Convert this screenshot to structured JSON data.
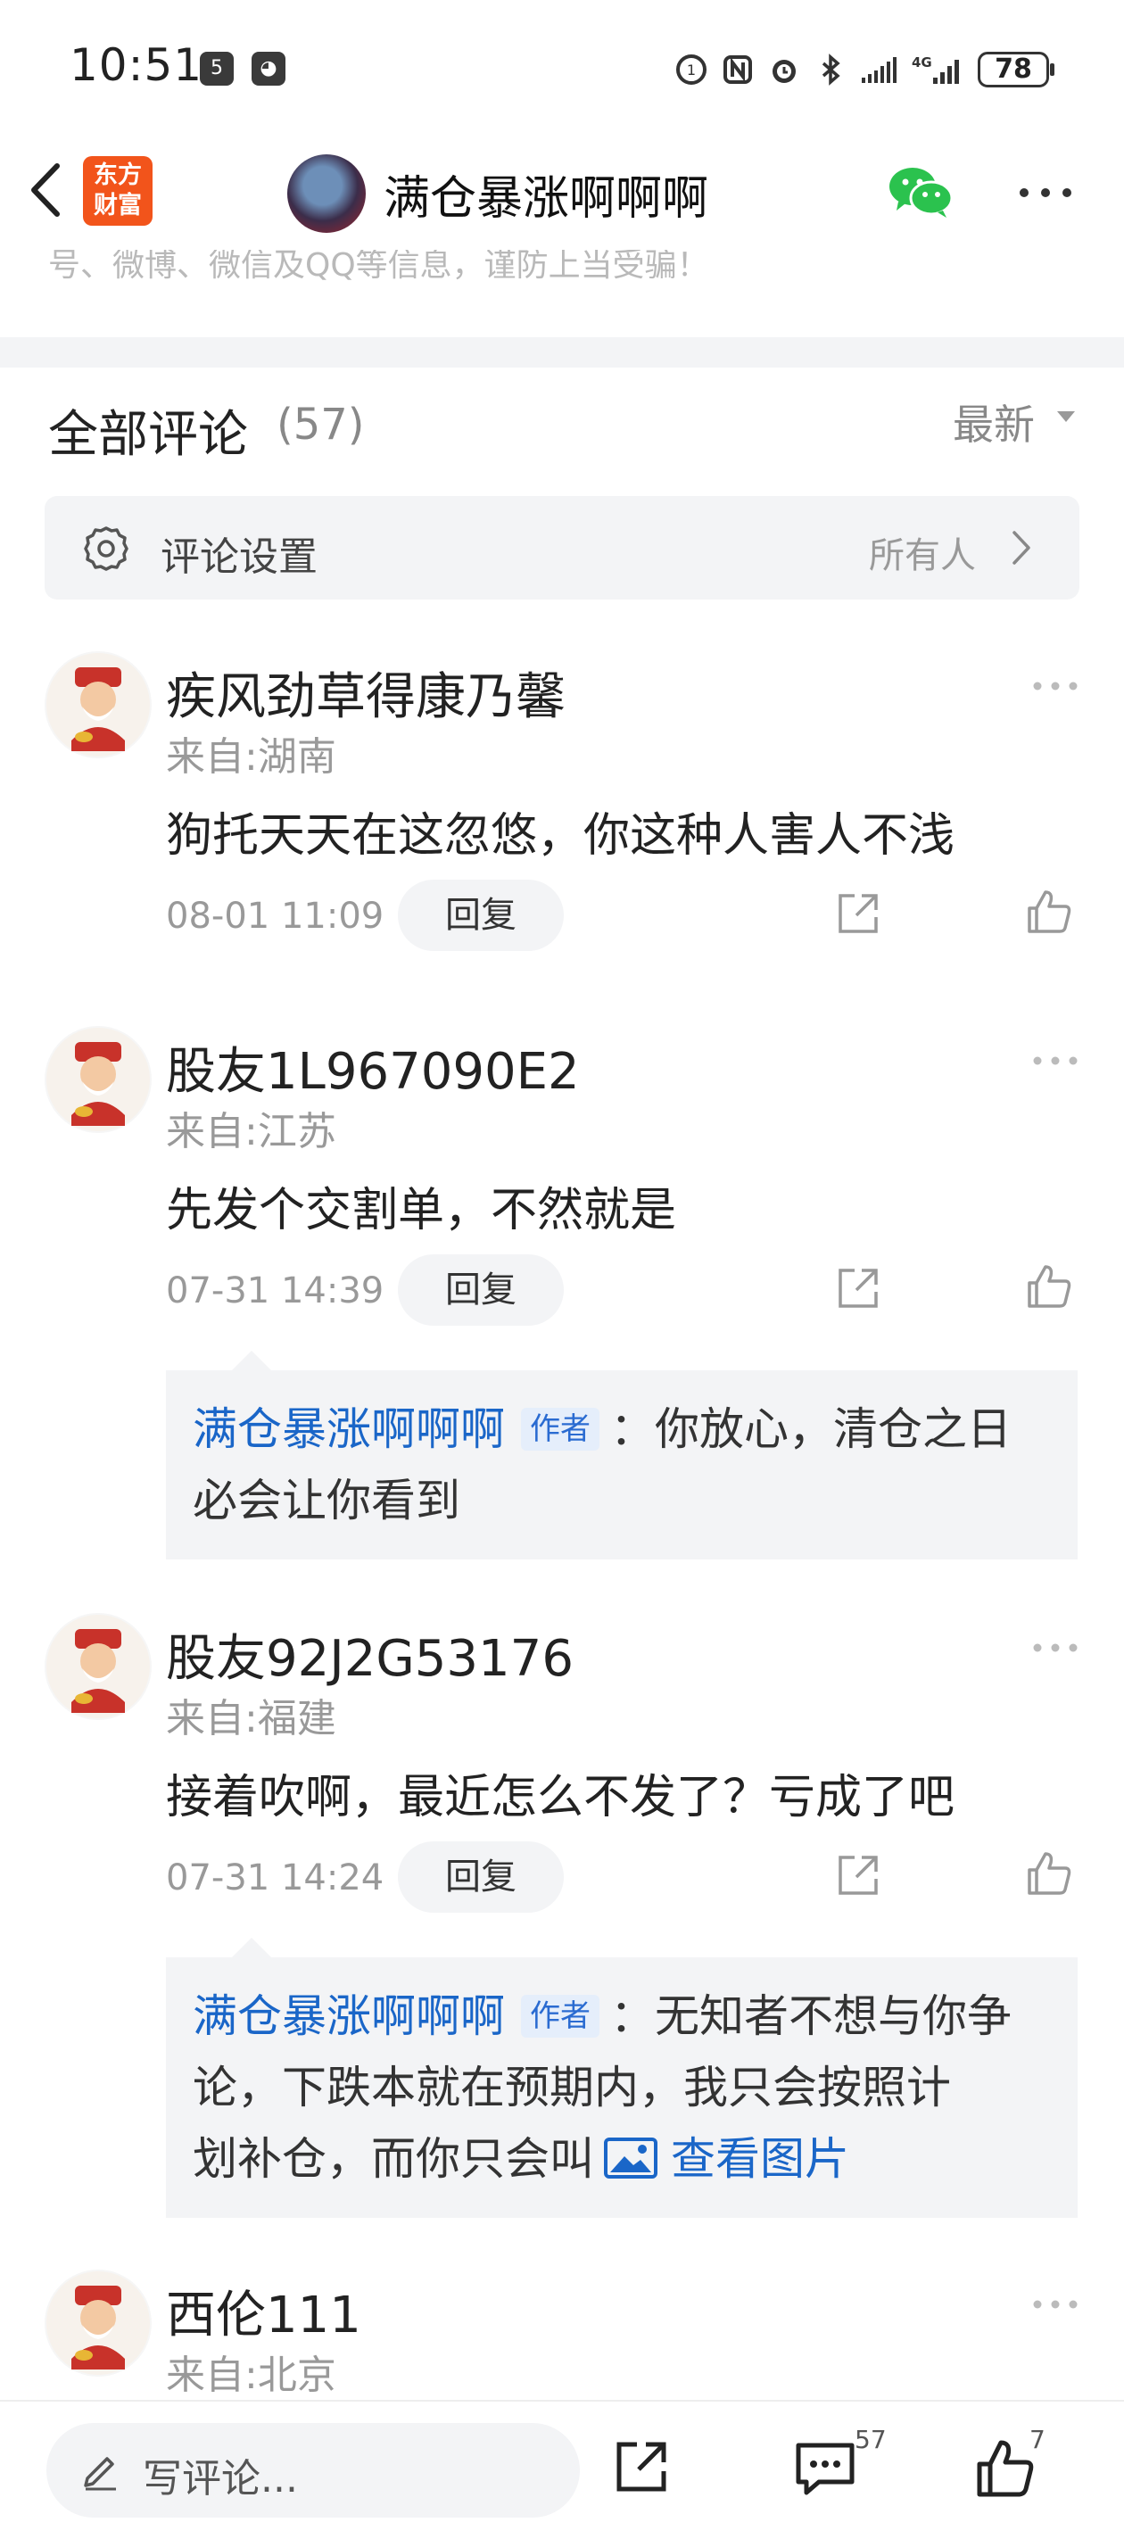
{
  "status_bar": {
    "time": "10:51",
    "network": "4G",
    "battery": "78"
  },
  "title_bar": {
    "logo_text": "东方\n财富",
    "title": "满仓暴涨啊啊啊",
    "icons": [
      "back-icon",
      "wechat-icon",
      "more-icon"
    ]
  },
  "notice": "号、微博、微信及QQ等信息，谨防上当受骗！",
  "comments_header": {
    "title": "全部评论",
    "count": "(57)",
    "sort_label": "最新"
  },
  "settings": {
    "label": "评论设置",
    "value": "所有人"
  },
  "comments": [
    {
      "name": "疾风劲草得康乃馨",
      "location": "来自:湖南",
      "text": "狗托天天在这忽悠，你这种人害人不浅",
      "time": "08-01 11:09",
      "reply_label": "回复"
    },
    {
      "name": "股友1L967090E2",
      "location": "来自:江苏",
      "text": "先发个交割单，不然就是",
      "time": "07-31 14:39",
      "reply_label": "回复",
      "reply": {
        "author": "满仓暴涨啊啊啊",
        "badge": "作者",
        "text_line1": "：你放心，清仓之日",
        "text_line2": "必会让你看到"
      }
    },
    {
      "name": "股友92J2G53176",
      "location": "来自:福建",
      "text": "接着吹啊，最近怎么不发了？亏成了吧",
      "time": "07-31 14:24",
      "reply_label": "回复",
      "reply": {
        "author": "满仓暴涨啊啊啊",
        "badge": "作者",
        "text_line1": "：无知者不想与你争",
        "text_line2": "论，下跌本就在预期内，我只会按照计",
        "text_line3": "划补仓，而你只会叫",
        "image_link": "查看图片"
      }
    },
    {
      "name": "西伦111",
      "location": "来自:北京"
    }
  ],
  "bottom_bar": {
    "write_placeholder": "写评论...",
    "comment_count": "57",
    "like_count": "7"
  },
  "colors": {
    "accent_blue": "#1a66c8",
    "logo_orange": "#f2541b",
    "muted_gray": "#999999",
    "panel_bg": "#f3f4f6"
  }
}
